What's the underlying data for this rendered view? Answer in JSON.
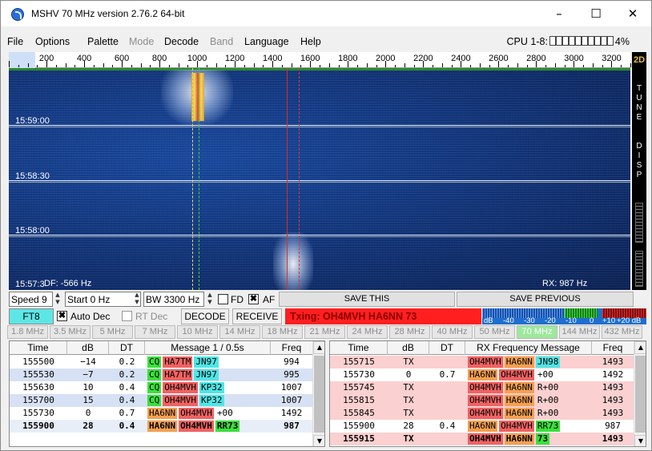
{
  "window": {
    "title": "MSHV 70 MHz version 2.76.2 64-bit",
    "minimize": "–",
    "maximize": "☐",
    "close": "✕"
  },
  "menu": [
    {
      "label": "File",
      "disabled": false
    },
    {
      "label": "Options",
      "disabled": false
    },
    {
      "label": "Palette",
      "disabled": false
    },
    {
      "label": "Mode",
      "disabled": true
    },
    {
      "label": "Decode",
      "disabled": false
    },
    {
      "label": "Band",
      "disabled": true
    },
    {
      "label": "Language",
      "disabled": false
    },
    {
      "label": "Help",
      "disabled": false
    }
  ],
  "cpu": {
    "label": "CPU 1-8:",
    "value": "4%"
  },
  "ruler": {
    "labels": [
      "200",
      "400",
      "600",
      "800",
      "1000",
      "1200",
      "1400",
      "1600",
      "1800",
      "2000",
      "2200",
      "2400",
      "2600",
      "2800",
      "3000",
      "3200"
    ],
    "mode_2d": "2D"
  },
  "waterfall": {
    "times": [
      "15:59:00",
      "15:58:30",
      "15:58:00",
      "15:57:3"
    ],
    "df": "DF: -566 Hz",
    "rx": "RX: 987 Hz",
    "side_text": "TUNE DISP"
  },
  "controls": {
    "speed": "Speed 9",
    "start": "Start 0 Hz",
    "bw": "BW 3300 Hz",
    "fd": "FD",
    "af": "AF",
    "af_checked": "✖",
    "save_this": "SAVE THIS",
    "save_previous": "SAVE PREVIOUS",
    "mode": "FT8",
    "auto_dec": "Auto Dec",
    "auto_dec_checked": "✖",
    "rt_dec": "RT Dec",
    "decode": "DECODE",
    "receive": "RECEIVE",
    "txing": "Txing: OH4MVH HA6NN 73",
    "db_labels": [
      "dB",
      "-40",
      "-30",
      "-20",
      "-10",
      "0",
      "+10",
      "+20 dB"
    ]
  },
  "bands": [
    "1.8 MHz",
    "3.5 MHz",
    "5 MHz",
    "7 MHz",
    "10 MHz",
    "14 MHz",
    "18 MHz",
    "21 MHz",
    "24 MHz",
    "28 MHz",
    "40 MHz",
    "50 MHz",
    "70 MHz",
    "144 MHz",
    "432 MHz"
  ],
  "selected_band": "70 MHz",
  "colors": {
    "cq": "#3be03b",
    "red_call": "#f06262",
    "orange_call": "#f5a050",
    "grid": "#4ee6e6",
    "rx_row_tx": "#fbd0d0",
    "alt_row": "#d7e1f5",
    "highlight_row": "#e8eef8"
  },
  "left_table": {
    "headers": [
      "Time",
      "dB",
      "DT",
      "Message 1 / 0.5s",
      "Freq"
    ],
    "rows": [
      {
        "time": "155500",
        "db": "−14",
        "dt": "0.2",
        "msg": [
          {
            "t": "CQ",
            "c": "cq"
          },
          {
            "t": "HA7TM",
            "c": "red"
          },
          {
            "t": "JN97",
            "c": "grid"
          }
        ],
        "freq": "994",
        "bg": "#ffffff",
        "bold": false
      },
      {
        "time": "155530",
        "db": "−7",
        "dt": "0.2",
        "msg": [
          {
            "t": "CQ",
            "c": "cq"
          },
          {
            "t": "HA7TM",
            "c": "red"
          },
          {
            "t": "JN97",
            "c": "grid"
          }
        ],
        "freq": "995",
        "bg": "#d7e1f5",
        "bold": false
      },
      {
        "time": "155630",
        "db": "10",
        "dt": "0.4",
        "msg": [
          {
            "t": "CQ",
            "c": "cq"
          },
          {
            "t": "OH4MVH",
            "c": "red"
          },
          {
            "t": "KP32",
            "c": "grid"
          }
        ],
        "freq": "1007",
        "bg": "#ffffff",
        "bold": false
      },
      {
        "time": "155700",
        "db": "15",
        "dt": "0.4",
        "msg": [
          {
            "t": "CQ",
            "c": "cq"
          },
          {
            "t": "OH4MVH",
            "c": "red"
          },
          {
            "t": "KP32",
            "c": "grid"
          }
        ],
        "freq": "1007",
        "bg": "#d7e1f5",
        "bold": false
      },
      {
        "time": "155730",
        "db": "0",
        "dt": "0.7",
        "msg": [
          {
            "t": "HA6NN",
            "c": "orange"
          },
          {
            "t": "OH4MVH",
            "c": "red"
          },
          {
            "t": "+00",
            "c": "none"
          }
        ],
        "freq": "1492",
        "bg": "#ffffff",
        "bold": false
      },
      {
        "time": "155900",
        "db": "28",
        "dt": "0.4",
        "msg": [
          {
            "t": "HA6NN",
            "c": "orange"
          },
          {
            "t": "OH4MVH",
            "c": "red"
          },
          {
            "t": "RR73",
            "c": "cq"
          }
        ],
        "freq": "987",
        "bg": "#e8eef8",
        "bold": true
      }
    ]
  },
  "right_table": {
    "headers": [
      "Time",
      "dB",
      "DT",
      "RX Frequency Message",
      "Freq"
    ],
    "rows": [
      {
        "time": "155715",
        "db": "TX",
        "dt": "",
        "msg": [
          {
            "t": "OH4MVH",
            "c": "red"
          },
          {
            "t": "HA6NN",
            "c": "orange"
          },
          {
            "t": "JN98",
            "c": "grid"
          }
        ],
        "freq": "1493",
        "bg": "#fbd0d0",
        "bold": false
      },
      {
        "time": "155730",
        "db": "0",
        "dt": "0.7",
        "msg": [
          {
            "t": "HA6NN",
            "c": "orange"
          },
          {
            "t": "OH4MVH",
            "c": "red"
          },
          {
            "t": "+00",
            "c": "none"
          }
        ],
        "freq": "1492",
        "bg": "#ffffff",
        "bold": false
      },
      {
        "time": "155745",
        "db": "TX",
        "dt": "",
        "msg": [
          {
            "t": "OH4MVH",
            "c": "red"
          },
          {
            "t": "HA6NN",
            "c": "orange"
          },
          {
            "t": "R+00",
            "c": "none"
          }
        ],
        "freq": "1493",
        "bg": "#fbd0d0",
        "bold": false
      },
      {
        "time": "155815",
        "db": "TX",
        "dt": "",
        "msg": [
          {
            "t": "OH4MVH",
            "c": "red"
          },
          {
            "t": "HA6NN",
            "c": "orange"
          },
          {
            "t": "R+00",
            "c": "none"
          }
        ],
        "freq": "1493",
        "bg": "#fbd0d0",
        "bold": false
      },
      {
        "time": "155845",
        "db": "TX",
        "dt": "",
        "msg": [
          {
            "t": "OH4MVH",
            "c": "red"
          },
          {
            "t": "HA6NN",
            "c": "orange"
          },
          {
            "t": "R+00",
            "c": "none"
          }
        ],
        "freq": "1493",
        "bg": "#fbd0d0",
        "bold": false
      },
      {
        "time": "155900",
        "db": "28",
        "dt": "0.4",
        "msg": [
          {
            "t": "HA6NN",
            "c": "orange"
          },
          {
            "t": "OH4MVH",
            "c": "red"
          },
          {
            "t": "RR73",
            "c": "cq"
          }
        ],
        "freq": "987",
        "bg": "#ffffff",
        "bold": false
      },
      {
        "time": "155915",
        "db": "TX",
        "dt": "",
        "msg": [
          {
            "t": "OH4MVH",
            "c": "red"
          },
          {
            "t": "HA6NN",
            "c": "orange"
          },
          {
            "t": "73",
            "c": "cq"
          }
        ],
        "freq": "1493",
        "bg": "#fbd0d0",
        "bold": true
      }
    ]
  }
}
